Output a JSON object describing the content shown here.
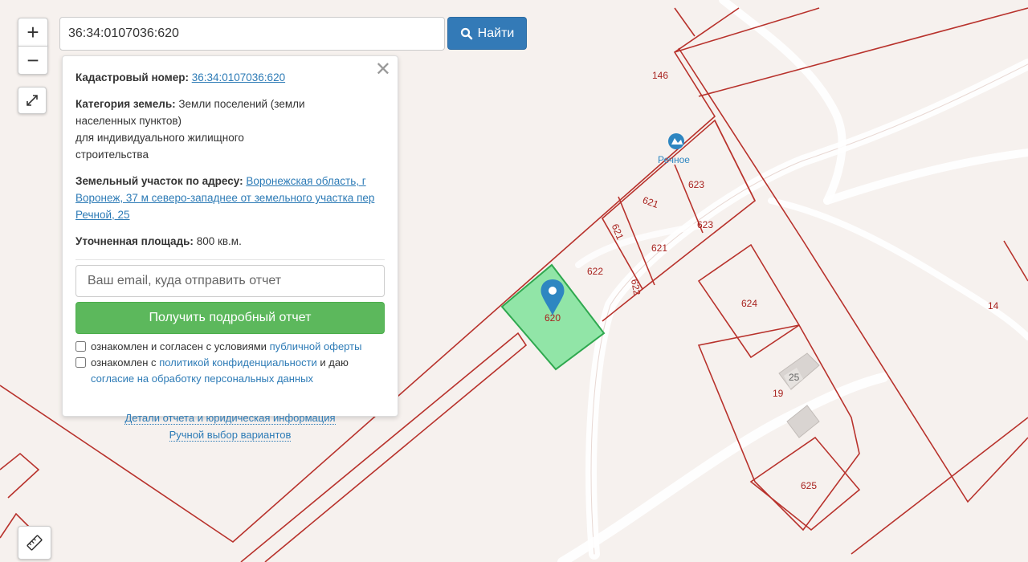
{
  "search": {
    "value": "36:34:0107036:620",
    "button_label": "Найти"
  },
  "controls": {
    "zoom_in": "+",
    "zoom_out": "−"
  },
  "info": {
    "cadastral_label": "Кадастровый номер:",
    "cadastral_value": "36:34:0107036:620",
    "category_label": "Категория земель:",
    "category_value": "Земли поселений (земли населенных пунктов)",
    "category_use": "для индивидуального жилищного строительства",
    "address_label": "Земельный участок по адресу:",
    "address_value": "Воронежская область, г Воронеж, 37 м северо-западнее от земельного участка пер Речной, 25",
    "area_label": "Уточненная площадь:",
    "area_value": "800 кв.м.",
    "email_placeholder": "Ваш email, куда отправить отчет",
    "report_button": "Получить подробный отчет",
    "check1_text": "ознакомлен и согласен с условиями",
    "check1_link": "публичной оферты",
    "check2_text": "ознакомлен с",
    "check2_link": "политикой конфиденциальности",
    "check2_suffix": "и даю",
    "check2_link2": "согласие на обработку персональных данных",
    "details_link": "Детали отчета и юридическая информация",
    "manual_link": "Ручной выбор вариантов"
  },
  "map": {
    "place_name": "Речное",
    "selected_plot": "620",
    "plot_labels": [
      "146",
      "623",
      "621",
      "621",
      "623",
      "621",
      "622",
      "622",
      "624",
      "14",
      "25",
      "19",
      "625"
    ],
    "colors": {
      "boundary": "#b8322c",
      "selected_fill": "#7fe39a",
      "selected_stroke": "#2fa84f",
      "road": "#ffffff",
      "marker": "#2e86c1"
    }
  }
}
